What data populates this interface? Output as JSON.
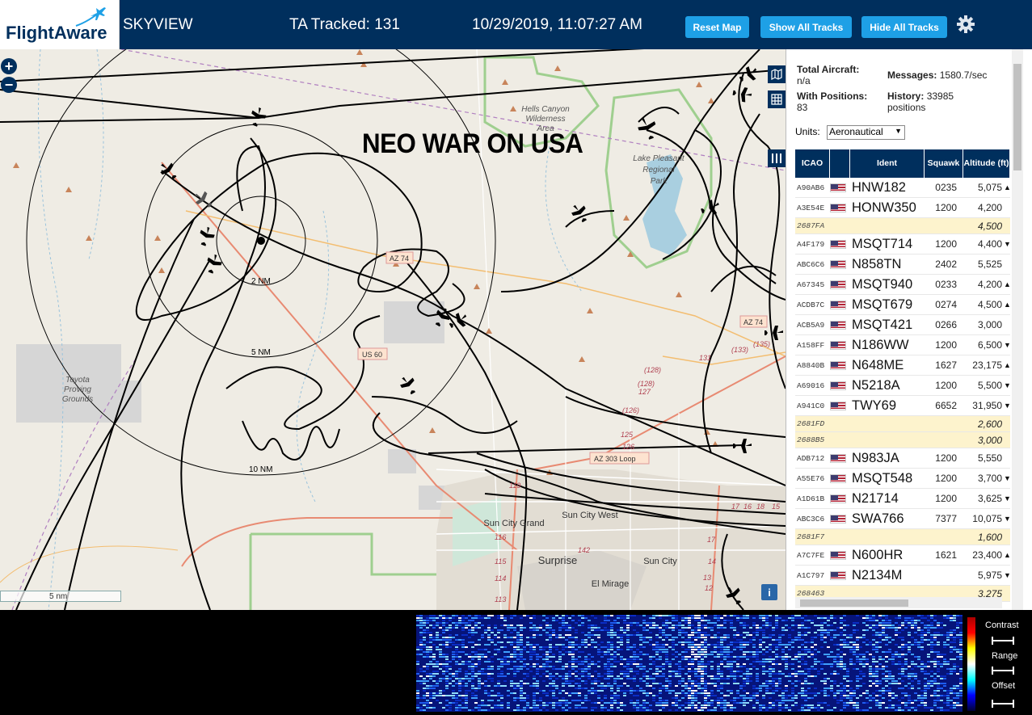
{
  "header": {
    "logo_text": "FlightAware",
    "app_name": "SKYVIEW",
    "tracked": "TA Tracked: 131",
    "datetime": "10/29/2019, 11:07:27 AM",
    "buttons": {
      "reset": "Reset Map",
      "show": "Show All Tracks",
      "hide": "Hide All Tracks"
    }
  },
  "map": {
    "overlay_text": "NEO WAR ON USA",
    "zoom_in": "+",
    "zoom_out": "−",
    "scale_label": "5 nm",
    "info": "i",
    "ring_labels": [
      "2 NM",
      "5 NM",
      "10 NM"
    ],
    "places": [
      "Hells Canyon Wilderness Area",
      "Lake Pleasant Regional Park",
      "Toyota Proving Grounds",
      "Sun City Grand",
      "Sun City West",
      "Surprise",
      "Sun City",
      "El Mirage"
    ],
    "shields": [
      "AZ 74",
      "AZ 74",
      "US 60",
      "AZ 303 Loop"
    ],
    "road_numbers": [
      "131",
      "(133)",
      "(135)",
      "(128)",
      "(128)",
      "127",
      "(126)",
      "125",
      "126",
      "123",
      "121",
      "119",
      "116",
      "115",
      "114",
      "113",
      "142",
      "14",
      "13",
      "12",
      "17",
      "16",
      "18",
      "15"
    ]
  },
  "panel": {
    "total_label": "Total Aircraft:",
    "total_value": "n/a",
    "messages_label": "Messages:",
    "messages_value": "1580.7/sec",
    "with_pos_label": "With Positions:",
    "with_pos_value": "83",
    "history_label": "History:",
    "history_value": "33985",
    "history_unit": "positions",
    "units_label": "Units:",
    "units_value": "Aeronautical",
    "columns": [
      "ICAO",
      "Ident",
      "Squawk",
      "Altitude (ft)"
    ],
    "rows": [
      {
        "icao": "A90AB6",
        "ident": "HNW182",
        "squawk": "0235",
        "alt": "5,075",
        "dir": "▲",
        "flag": true
      },
      {
        "icao": "A3E54E",
        "ident": "HONW350",
        "squawk": "1200",
        "alt": "4,200",
        "dir": "",
        "flag": true
      },
      {
        "icao": "2687FA",
        "ident": "",
        "squawk": "",
        "alt": "4,500",
        "dir": "",
        "flag": false
      },
      {
        "icao": "A4F179",
        "ident": "MSQT714",
        "squawk": "1200",
        "alt": "4,400",
        "dir": "▼",
        "flag": true
      },
      {
        "icao": "ABC6C6",
        "ident": "N858TN",
        "squawk": "2402",
        "alt": "5,525",
        "dir": "",
        "flag": true
      },
      {
        "icao": "A67345",
        "ident": "MSQT940",
        "squawk": "0233",
        "alt": "4,200",
        "dir": "▲",
        "flag": true
      },
      {
        "icao": "ACDB7C",
        "ident": "MSQT679",
        "squawk": "0274",
        "alt": "4,500",
        "dir": "▲",
        "flag": true
      },
      {
        "icao": "ACB5A9",
        "ident": "MSQT421",
        "squawk": "0266",
        "alt": "3,000",
        "dir": "",
        "flag": true
      },
      {
        "icao": "A158FF",
        "ident": "N186WW",
        "squawk": "1200",
        "alt": "6,500",
        "dir": "▼",
        "flag": true
      },
      {
        "icao": "A8840B",
        "ident": "N648ME",
        "squawk": "1627",
        "alt": "23,175",
        "dir": "▲",
        "flag": true
      },
      {
        "icao": "A69016",
        "ident": "N5218A",
        "squawk": "1200",
        "alt": "5,500",
        "dir": "▼",
        "flag": true
      },
      {
        "icao": "A941C0",
        "ident": "TWY69",
        "squawk": "6652",
        "alt": "31,950",
        "dir": "▼",
        "flag": true
      },
      {
        "icao": "2681FD",
        "ident": "",
        "squawk": "",
        "alt": "2,600",
        "dir": "",
        "flag": false
      },
      {
        "icao": "2688B5",
        "ident": "",
        "squawk": "",
        "alt": "3,000",
        "dir": "",
        "flag": false
      },
      {
        "icao": "ADB712",
        "ident": "N983JA",
        "squawk": "1200",
        "alt": "5,550",
        "dir": "",
        "flag": true
      },
      {
        "icao": "A55E76",
        "ident": "MSQT548",
        "squawk": "1200",
        "alt": "3,700",
        "dir": "▼",
        "flag": true
      },
      {
        "icao": "A1D61B",
        "ident": "N21714",
        "squawk": "1200",
        "alt": "3,625",
        "dir": "▼",
        "flag": true
      },
      {
        "icao": "ABC3C6",
        "ident": "SWA766",
        "squawk": "7377",
        "alt": "10,075",
        "dir": "▼",
        "flag": true
      },
      {
        "icao": "2681F7",
        "ident": "",
        "squawk": "",
        "alt": "1,600",
        "dir": "",
        "flag": false
      },
      {
        "icao": "A7C7FE",
        "ident": "N600HR",
        "squawk": "1621",
        "alt": "23,400",
        "dir": "▲",
        "flag": true
      },
      {
        "icao": "A1C797",
        "ident": "N2134M",
        "squawk": "",
        "alt": "5,975",
        "dir": "▼",
        "flag": true
      },
      {
        "icao": "268463",
        "ident": "",
        "squawk": "",
        "alt": "3,275",
        "dir": "",
        "flag": false
      }
    ]
  },
  "spectrum": {
    "contrast": "Contrast",
    "range": "Range",
    "offset": "Offset"
  },
  "colors": {
    "header_bg": "#002f5d",
    "button": "#1ea0e6",
    "map_bg": "#efece4",
    "noid_row": "#fdf3cd"
  }
}
